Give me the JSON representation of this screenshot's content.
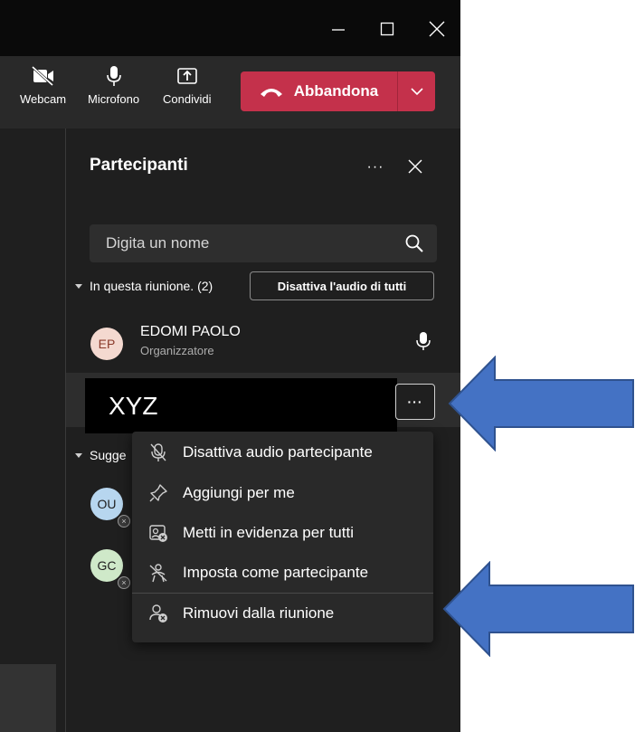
{
  "toolbar": {
    "webcam_label": "Webcam",
    "mic_label": "Microfono",
    "share_label": "Condividi",
    "leave_label": "Abbandona"
  },
  "panel": {
    "title": "Partecipanti",
    "more_label": "···",
    "search_placeholder": "Digita un nome",
    "section_in_meeting": "In questa riunione. (2)",
    "mute_all_label": "Disattiva l'audio di tutti",
    "section_suggested": "Sugge"
  },
  "participants": [
    {
      "initials": "EP",
      "name": "EDOMI PAOLO",
      "role": "Organizzatore"
    },
    {
      "name": "XYZ",
      "more_label": "···"
    }
  ],
  "suggested": [
    {
      "initials": "OU"
    },
    {
      "initials": "GC"
    }
  ],
  "context_menu": {
    "items": [
      {
        "label": "Disattiva audio partecipante",
        "icon": "mic-off-icon"
      },
      {
        "label": "Aggiungi per me",
        "icon": "pin-icon"
      },
      {
        "label": "Metti in evidenza per tutti",
        "icon": "spotlight-icon"
      },
      {
        "label": "Imposta come partecipante",
        "icon": "attendee-icon"
      },
      {
        "label": "Rimuovi dalla riunione",
        "icon": "remove-person-icon"
      }
    ]
  },
  "colors": {
    "leave_red": "#c4314b",
    "annotation_arrow": "#4472c4",
    "avatar_ep": "#f4d9d0",
    "avatar_ou": "#b7d6ef",
    "avatar_gc": "#cfe9c9"
  }
}
